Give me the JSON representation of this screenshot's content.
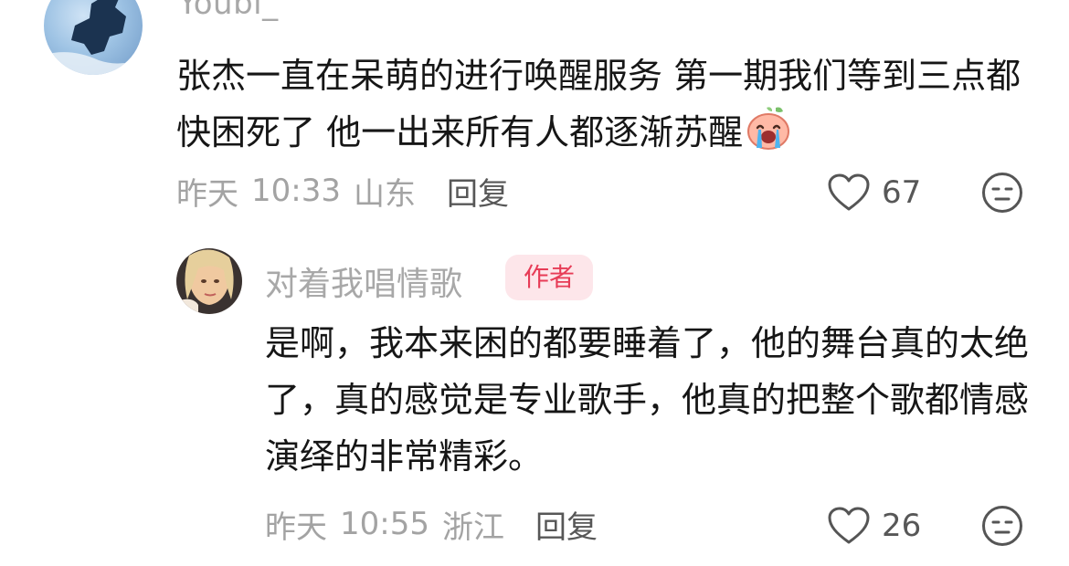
{
  "comment": {
    "username": "Youbi_",
    "text": "张杰一直在呆萌的进行唤醒服务 第一期我们等到三点都快困死了 他一出来所有人都逐渐苏醒",
    "emoji": "crying-face-emoji",
    "date": "昨天",
    "time": "10:33",
    "location": "山东",
    "reply_label": "回复",
    "likes": "67",
    "icons": {
      "like": "heart-outline-icon",
      "dislike": "unamused-face-icon"
    }
  },
  "reply": {
    "username": "对着我唱情歌",
    "badge": "作者",
    "text": "是啊，我本来困的都要睡着了，他的舞台真的太绝了，真的感觉是专业歌手，他真的把整个歌都情感演绎的非常精彩。",
    "date": "昨天",
    "time": "10:55",
    "location": "浙江",
    "reply_label": "回复",
    "likes": "26",
    "icons": {
      "like": "heart-outline-icon",
      "dislike": "unamused-face-icon"
    }
  },
  "colors": {
    "badge_text": "#e73c57",
    "badge_background": "#fde6ea",
    "meta_text": "#a3a3a3",
    "body_text": "#161616"
  }
}
